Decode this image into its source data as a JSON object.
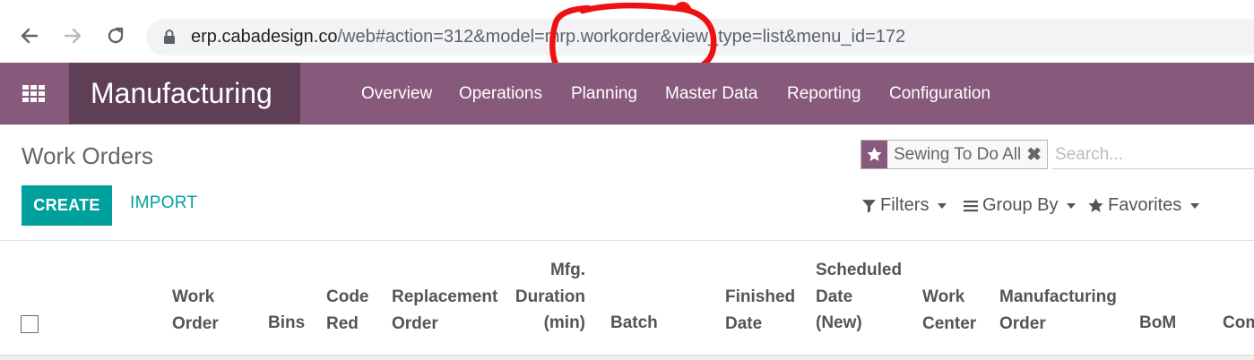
{
  "browser": {
    "url_host": "erp.cabadesign.co",
    "url_path": "/web#action=312&model=mrp.workorder&view_type=list&menu_id=172"
  },
  "navbar": {
    "brand": "Manufacturing",
    "menu": [
      "Overview",
      "Operations",
      "Planning",
      "Master Data",
      "Reporting",
      "Configuration"
    ]
  },
  "control_panel": {
    "title": "Work Orders",
    "facet_label": "Sewing To Do All",
    "search_placeholder": "Search...",
    "create_label": "CREATE",
    "import_label": "IMPORT",
    "filters_label": "Filters",
    "group_by_label": "Group By",
    "favorites_label": "Favorites"
  },
  "table": {
    "columns": [
      [
        "Work",
        "Order"
      ],
      [
        "Bins"
      ],
      [
        "Code",
        "Red"
      ],
      [
        "Replacement",
        "Order"
      ],
      [
        "Mfg.",
        "Duration",
        "(min)"
      ],
      [
        "Batch"
      ],
      [
        "Finished",
        "Date"
      ],
      [
        "Scheduled",
        "Date",
        "(New)"
      ],
      [
        "Work",
        "Center"
      ],
      [
        "Manufacturing",
        "Order"
      ],
      [
        "BoM"
      ],
      [
        "Com"
      ]
    ]
  },
  "colors": {
    "brand_purple": "#875a7b",
    "brand_dark": "#5f3f56",
    "accent_teal": "#00a09d",
    "annotation_red": "#ee1111"
  }
}
